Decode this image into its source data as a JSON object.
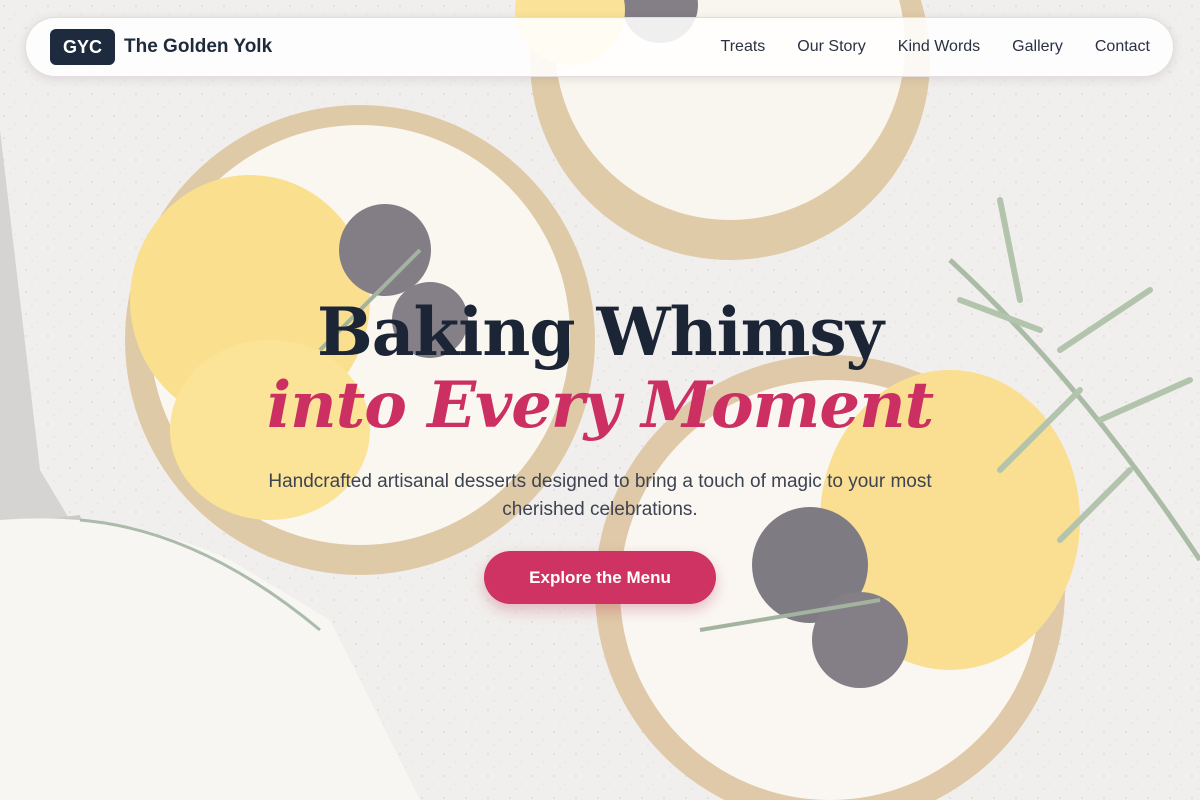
{
  "brand": {
    "logo_text": "GYC",
    "name": "The Golden Yolk"
  },
  "nav": {
    "items": [
      {
        "label": "Treats"
      },
      {
        "label": "Our Story"
      },
      {
        "label": "Kind Words"
      },
      {
        "label": "Gallery"
      },
      {
        "label": "Contact"
      }
    ]
  },
  "hero": {
    "headline_line1": "Baking Whimsy",
    "headline_line2": "into Every Moment",
    "subtitle": "Handcrafted artisanal desserts designed to bring a touch of magic to your most cherished celebrations.",
    "cta_label": "Explore the Menu"
  },
  "colors": {
    "navy": "#1e2a3d",
    "accent_pink": "#cf3363",
    "background_stone": "#e9e6e4"
  },
  "icons": {
    "background_image": "citrus-blackberry-tarts-photo"
  }
}
